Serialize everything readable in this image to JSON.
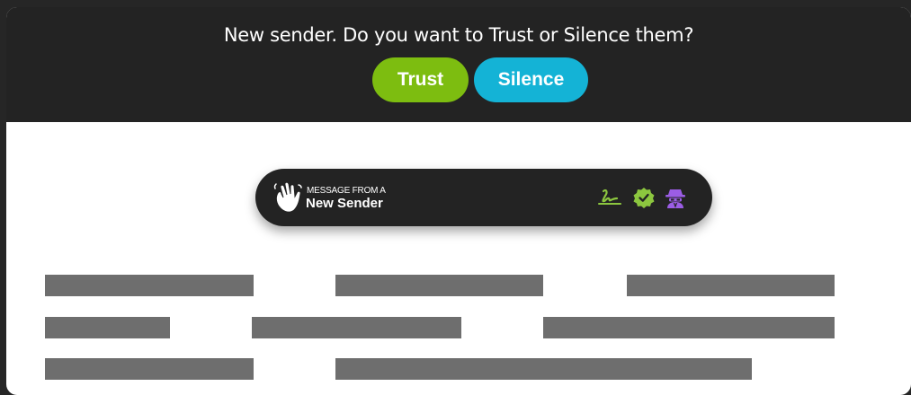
{
  "banner": {
    "prompt": "New sender. Do you want to Trust or Silence them?",
    "trust_label": "Trust",
    "silence_label": "Silence"
  },
  "sender_pill": {
    "caption": "MESSAGE FROM A",
    "name": "New Sender",
    "icons": [
      "waving-hand-icon",
      "signature-icon",
      "verified-check-icon",
      "spy-icon"
    ]
  },
  "colors": {
    "trust": "#7dbd10",
    "silence": "#14b3d6",
    "icon_green": "#8cc63f",
    "icon_purple": "#9b5de5",
    "dark": "#232323",
    "placeholder_bar": "#6e6e6e"
  }
}
